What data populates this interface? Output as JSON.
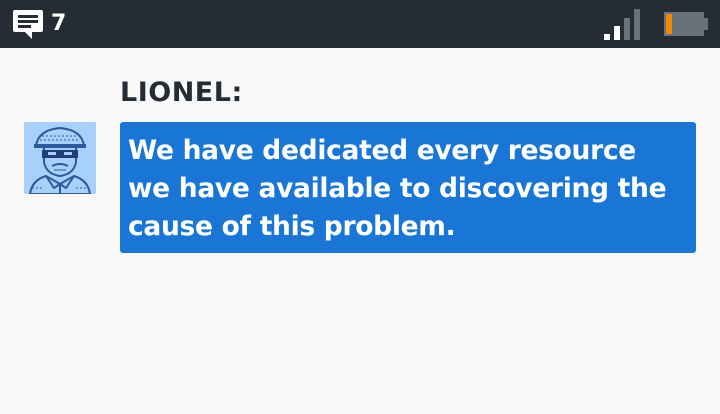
{
  "status_bar": {
    "message_icon": "chat-bubble-icon",
    "message_count": "7",
    "signal_icon": "signal-bars-icon",
    "signal_level": 0.5,
    "battery_icon": "battery-icon",
    "battery_level": 0.15,
    "battery_color": "#f08a00"
  },
  "dialog": {
    "speaker": "LIONEL:",
    "avatar_icon": "detective-portrait-icon",
    "message": "We have dedicated every resource we have available to discovering the cause of this problem."
  },
  "colors": {
    "status_bar_bg": "#262c33",
    "background": "#f9f9f9",
    "bubble_bg": "#1976d6",
    "avatar_bg": "#a8d0fb",
    "avatar_line": "#2a5a9c"
  }
}
